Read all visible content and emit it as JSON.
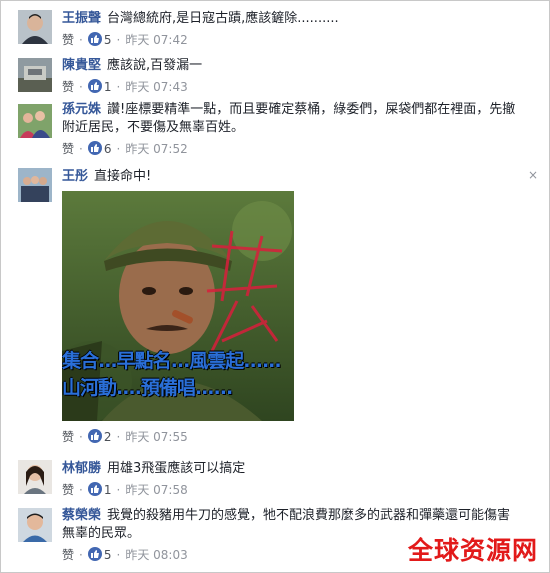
{
  "ui": {
    "like_label": "赞",
    "time_label": "昨天",
    "close_glyph": "×"
  },
  "comments": [
    {
      "author": "王振聲",
      "text": "台灣總統府,是日寇古蹟,應該鏟除..........",
      "likes": "5",
      "time": "07:42"
    },
    {
      "author": "陳貴堅",
      "text": "應該說,百發漏一",
      "likes": "1",
      "time": "07:43"
    },
    {
      "author": "孫元姝",
      "text": "讚!座標要精準一點，而且要確定蔡桶，綠委們，屎袋們都在裡面，先撤附近居民，不要傷及無辜百姓。",
      "likes": "6",
      "time": "07:52"
    },
    {
      "author": "王彤",
      "text": "直接命中!",
      "likes": "2",
      "time": "07:55",
      "image": {
        "caption_line1": "集合...早點名...風雲起......",
        "caption_line2": "山河動....預備唱......",
        "stamp": "殺"
      }
    },
    {
      "author": "林郁勝",
      "text": "用雄3飛蛋應該可以搞定",
      "likes": "1",
      "time": "07:58"
    },
    {
      "author": "蔡榮榮",
      "text": "我覺的殺豬用牛刀的感覺，牠不配浪費那麼多的武器和彈藥還可能傷害無辜的民眾。",
      "likes": "5",
      "time": "08:03"
    }
  ],
  "watermark": "全球资源网",
  "colors": {
    "author": "#365899",
    "meta": "#90949c",
    "like_icon": "#4267b2",
    "watermark": "#e21a1a"
  }
}
